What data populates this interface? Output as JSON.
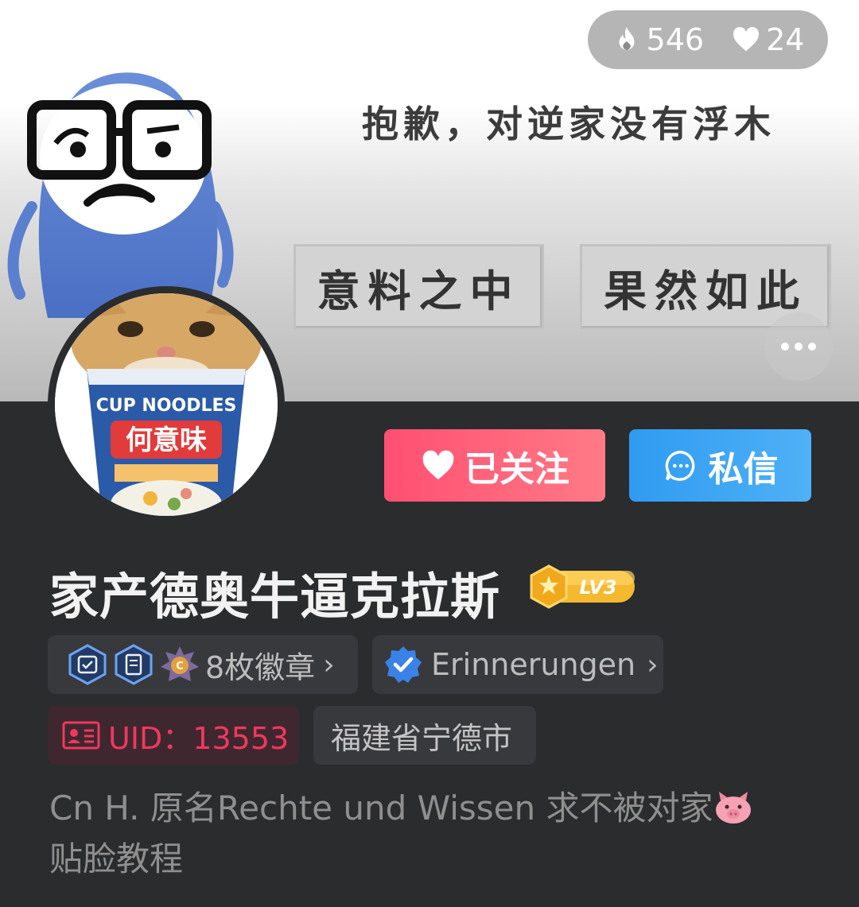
{
  "stats": {
    "heat": "546",
    "likes": "24"
  },
  "banner": {
    "caption": "抱歉，对逆家没有浮木",
    "button_left": "意料之中",
    "button_right": "果然如此"
  },
  "actions": {
    "follow_label": "已关注",
    "message_label": "私信"
  },
  "profile": {
    "username": "家产德奥牛逼克拉斯",
    "level": "LV3",
    "badges_label": "8枚徽章",
    "verify_label": "Erinnerungen",
    "uid_label": "UID：",
    "uid_value": "13553",
    "location": "福建省宁德市",
    "bio_line1": "Cn H. 原名Rechte und Wissen 求不被对家",
    "bio_line2": "贴脸教程"
  },
  "colors": {
    "follow": "#ff5a78",
    "message": "#3aa4f3",
    "uid": "#f0385e",
    "background": "#2b2c2e"
  },
  "icons": {
    "heat": "flame-icon",
    "likes": "heart-icon",
    "more": "more-dots-icon",
    "message": "chat-bubble-icon",
    "verify": "verified-check-icon",
    "uid": "id-card-icon",
    "bio_emoji": "pig-icon"
  }
}
